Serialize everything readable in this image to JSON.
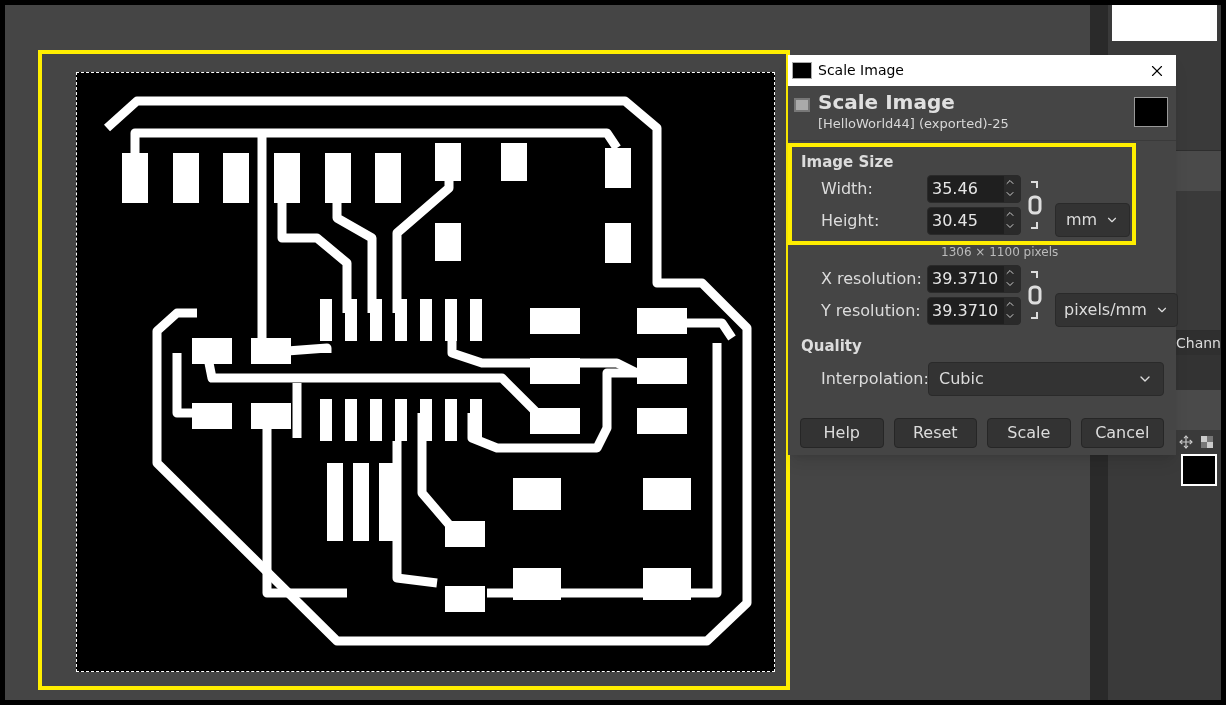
{
  "dialog": {
    "title": "Scale Image",
    "header_title": "Scale Image",
    "header_subtitle": "[HelloWorld44] (exported)-25",
    "image_size": {
      "heading": "Image Size",
      "fields": [
        {
          "label": "Width:",
          "value": "35.46"
        },
        {
          "label": "Height:",
          "value": "30.45"
        }
      ],
      "unit": "mm",
      "pixel_size": "1306 × 1100 pixels"
    },
    "resolution": {
      "fields": [
        {
          "label": "X resolution:",
          "value": "39.3710"
        },
        {
          "label": "Y resolution:",
          "value": "39.3710"
        }
      ],
      "unit": "pixels/mm"
    },
    "quality": {
      "heading": "Quality",
      "interpolation": {
        "label": "Interpolation:",
        "value": "Cubic"
      }
    },
    "buttons": [
      "Help",
      "Reset",
      "Scale",
      "Cancel"
    ]
  },
  "dock": {
    "tab_label": "Chann"
  }
}
